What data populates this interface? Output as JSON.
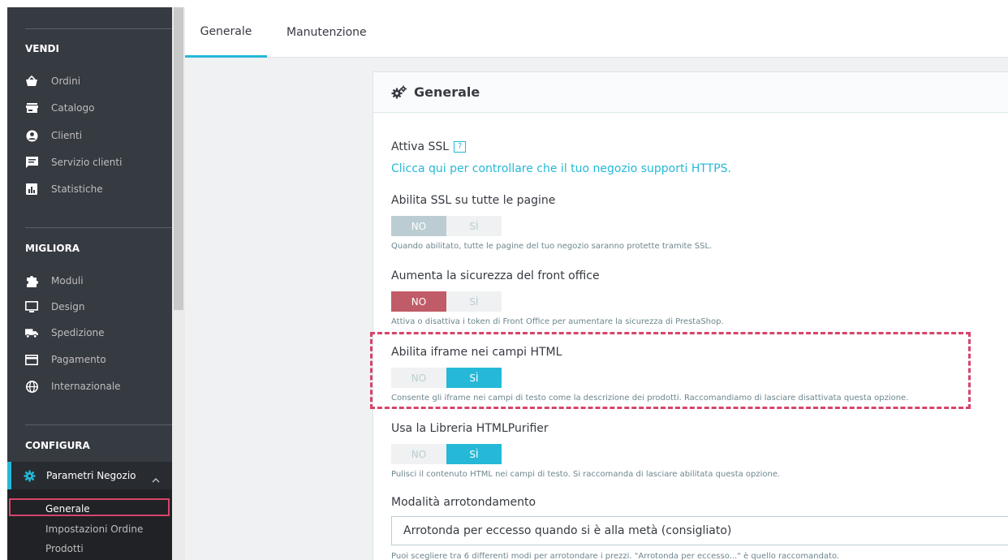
{
  "sidebar": {
    "sections": [
      {
        "title": "VENDI",
        "items": [
          {
            "label": "Ordini",
            "icon": "basket-icon"
          },
          {
            "label": "Catalogo",
            "icon": "store-icon"
          },
          {
            "label": "Clienti",
            "icon": "account-circle-icon"
          },
          {
            "label": "Servizio clienti",
            "icon": "chat-icon"
          },
          {
            "label": "Statistiche",
            "icon": "bar-chart-icon"
          }
        ]
      },
      {
        "title": "MIGLIORA",
        "items": [
          {
            "label": "Moduli",
            "icon": "puzzle-icon"
          },
          {
            "label": "Design",
            "icon": "monitor-icon"
          },
          {
            "label": "Spedizione",
            "icon": "truck-icon"
          },
          {
            "label": "Pagamento",
            "icon": "credit-card-icon"
          },
          {
            "label": "Internazionale",
            "icon": "globe-icon"
          }
        ]
      },
      {
        "title": "CONFIGURA",
        "items": [
          {
            "label": "Parametri Negozio",
            "icon": "gear-icon"
          }
        ]
      }
    ],
    "submenu": [
      "Generale",
      "Impostazioni Ordine",
      "Prodotti"
    ]
  },
  "tabs": [
    "Generale",
    "Manutenzione"
  ],
  "card": {
    "title": "Generale",
    "ssl": {
      "label": "Attiva SSL",
      "help_badge": "?",
      "link": "Clicca qui per controllare che il tuo negozio supporti HTTPS."
    },
    "settings": [
      {
        "label": "Abilita SSL su tutte le pagine",
        "no": "NO",
        "yes": "SÌ",
        "value": "NO",
        "help": "Quando abilitato, tutte le pagine del tuo negozio saranno protette tramite SSL."
      },
      {
        "label": "Aumenta la sicurezza del front office",
        "no": "NO",
        "yes": "SÌ",
        "value": "NO",
        "help": "Attiva o disattiva i token di Front Office per aumentare la sicurezza di PrestaShop."
      },
      {
        "label": "Abilita iframe nei campi HTML",
        "no": "NO",
        "yes": "SÌ",
        "value": "SÌ",
        "help": "Consente gli iframe nei campi di testo come la descrizione dei prodotti. Raccomandiamo di lasciare disattivata questa opzione."
      },
      {
        "label": "Usa la Libreria HTMLPurifier",
        "no": "NO",
        "yes": "SÌ",
        "value": "SÌ",
        "help": "Pulisci il contenuto HTML nei campi di testo. Si raccomanda di lasciare abilitata questa opzione."
      }
    ],
    "rounding": {
      "label": "Modalità arrotondamento",
      "selected": "Arrotonda per eccesso quando si è alla metà (consigliato)",
      "help": "Puoi scegliere tra 6 differenti modi per arrotondare i prezzi. \"Arrotonda per eccesso...\" è quello raccomandato."
    }
  },
  "colors": {
    "accent": "#25b9d7",
    "danger": "#c05c67",
    "sidebar_bg": "#363a41",
    "highlight": "#d6446a"
  }
}
